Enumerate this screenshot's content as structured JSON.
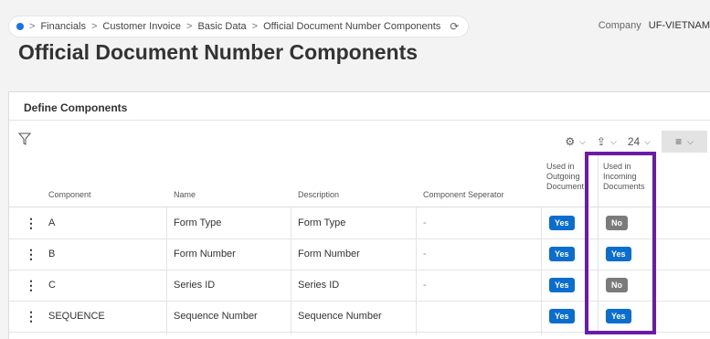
{
  "breadcrumb": {
    "items": [
      "Financials",
      "Customer Invoice",
      "Basic Data",
      "Official Document Number Components"
    ],
    "separator": ">"
  },
  "company": {
    "label": "Company",
    "value": "UF-VIETNAM"
  },
  "page_title": "Official Document Number Components",
  "panel": {
    "title": "Define Components"
  },
  "toolbar": {
    "page_size": "24"
  },
  "table": {
    "columns": {
      "component": "Component",
      "name": "Name",
      "description": "Description",
      "separator": "Component Seperator",
      "outgoing": [
        "Used in",
        "Outgoing",
        "Document"
      ],
      "incoming": [
        "Used in",
        "Incoming",
        "Documents"
      ]
    },
    "rows": [
      {
        "component": "A",
        "name": "Form Type",
        "description": "Form Type",
        "separator": "-",
        "outgoing": "Yes",
        "incoming": "No"
      },
      {
        "component": "B",
        "name": "Form Number",
        "description": "Form Number",
        "separator": "-",
        "outgoing": "Yes",
        "incoming": "Yes"
      },
      {
        "component": "C",
        "name": "Series ID",
        "description": "Series ID",
        "separator": "-",
        "outgoing": "Yes",
        "incoming": "No"
      },
      {
        "component": "SEQUENCE",
        "name": "Sequence Number",
        "description": "Sequence Number",
        "separator": "",
        "outgoing": "Yes",
        "incoming": "Yes"
      }
    ]
  },
  "colors": {
    "yes": "#0a6ed1",
    "no": "#7b7b7b",
    "highlight": "#6a1ba8"
  },
  "icons": {
    "filter": "filter-icon",
    "settings": "gear-icon",
    "export": "export-icon",
    "view": "list-view-icon",
    "refresh": "refresh-icon"
  }
}
